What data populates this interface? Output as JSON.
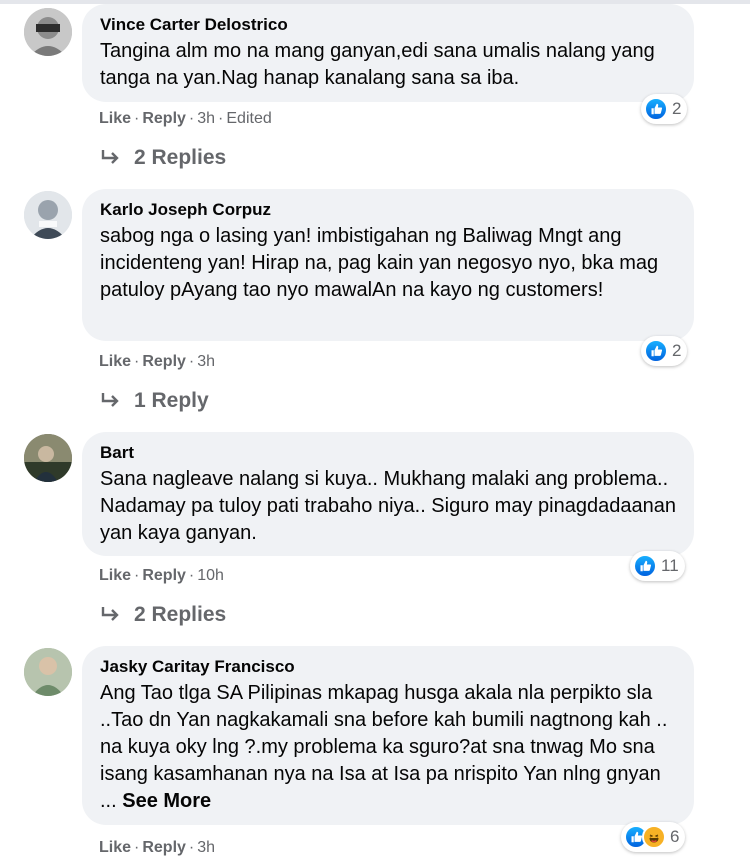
{
  "comments": [
    {
      "author": "Vince Carter Delostrico",
      "text": "Tangina alm mo na mang ganyan,edi sana umalis nalang yang tanga na yan.Nag hanap kanalang sana sa iba.",
      "actions": {
        "like": "Like",
        "reply": "Reply",
        "time": "3h",
        "edited": "Edited"
      },
      "reaction_count": "2",
      "replies": "2 Replies"
    },
    {
      "author": "Karlo Joseph Corpuz",
      "text": "sabog nga o lasing yan! imbistigahan ng Baliwag Mngt ang incidenteng yan! Hirap na, pag kain yan negosyo nyo, bka mag patuloy pAyang tao nyo mawalAn na kayo ng customers!",
      "actions": {
        "like": "Like",
        "reply": "Reply",
        "time": "3h"
      },
      "reaction_count": "2",
      "replies": "1 Reply"
    },
    {
      "author": "Bart",
      "text": "Sana nagleave nalang si kuya.. Mukhang malaki ang problema.. Nadamay pa tuloy pati trabaho niya.. Siguro may pinagdadaanan yan kaya ganyan.",
      "actions": {
        "like": "Like",
        "reply": "Reply",
        "time": "10h"
      },
      "reaction_count": "11",
      "replies": "2 Replies"
    },
    {
      "author": "Jasky Caritay Francisco",
      "text": "Ang Tao tlga SA Pilipinas mkapag husga akala nla perpikto sla ..Tao dn Yan nagkakamali sna before kah bumili nagtnong kah .. na kuya oky lng ?.my problema ka sguro?at sna tnwag Mo sna isang kasamhanan nya na Isa at Isa pa nrispito Yan nlng gnyan ...",
      "see_more": "See More",
      "actions": {
        "like": "Like",
        "reply": "Reply",
        "time": "3h"
      },
      "reaction_count": "6"
    }
  ],
  "dot": "·",
  "colors": {
    "like_blue": "#0866ff",
    "bubble_bg": "#f0f2f5",
    "meta_gray": "#65676b"
  },
  "icons": [
    "like-icon",
    "haha-icon",
    "reply-arrow-icon"
  ]
}
